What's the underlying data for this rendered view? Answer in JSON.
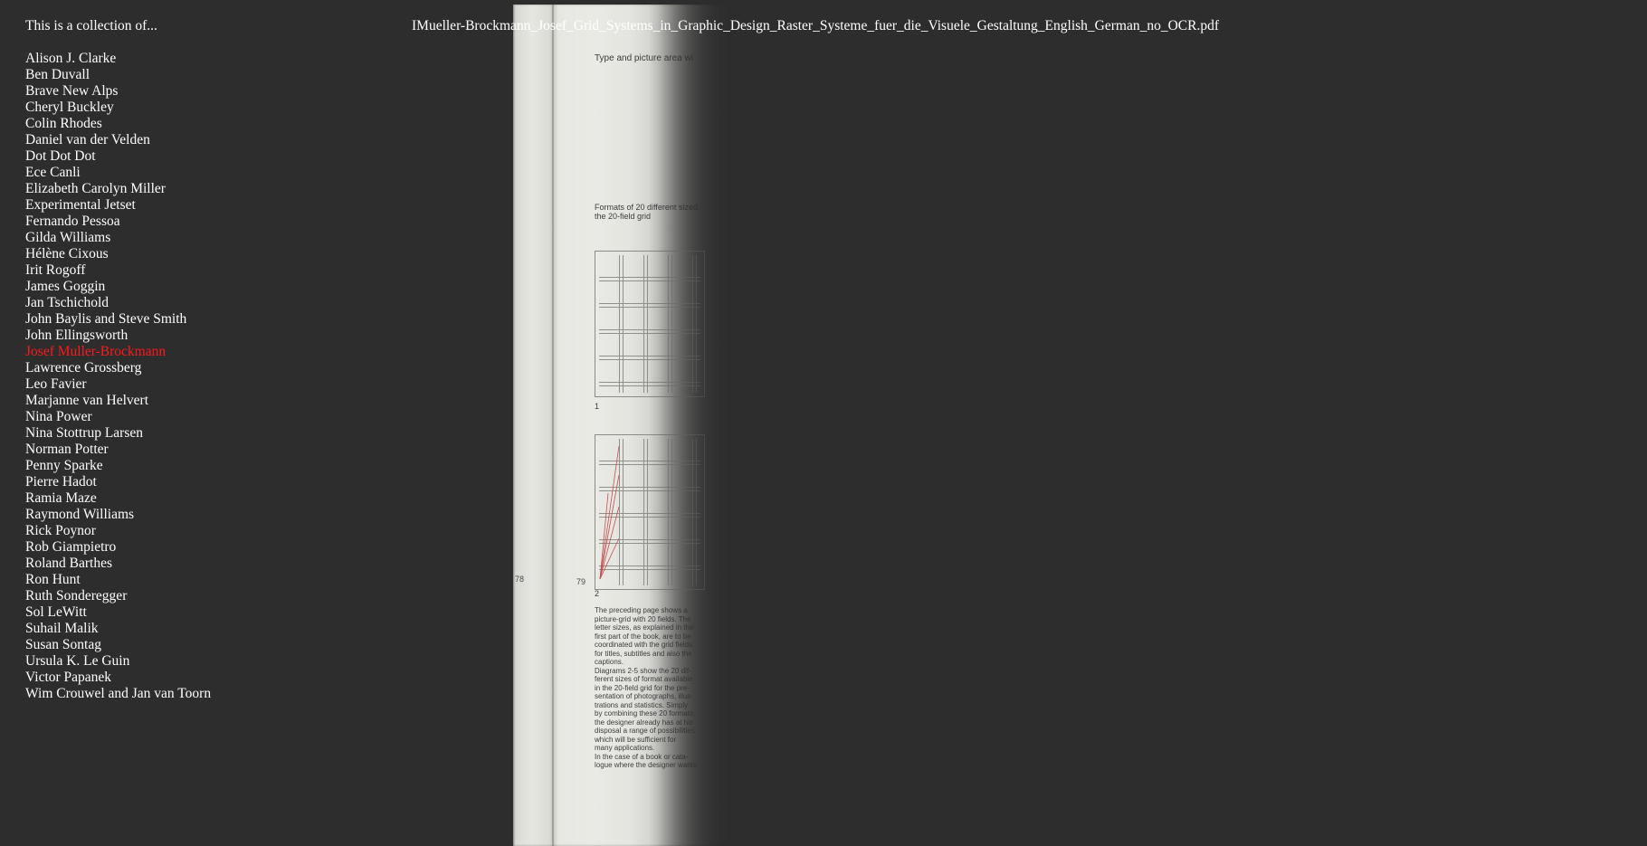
{
  "sidebar": {
    "intro": "This is a collection of...",
    "items": [
      "Alison J. Clarke",
      "Ben Duvall",
      "Brave New Alps",
      "Cheryl Buckley",
      "Colin Rhodes",
      "Daniel van der Velden",
      "Dot Dot Dot",
      "Ece Canli",
      "Elizabeth Carolyn Miller",
      "Experimental Jetset",
      "Fernando Pessoa",
      "Gilda Williams",
      "Hélène Cixous",
      "Irit Rogoff",
      "James Goggin",
      "Jan Tschichold",
      "John Baylis and Steve Smith",
      "John Ellingsworth",
      "Josef Muller-Brockmann",
      "Lawrence Grossberg",
      "Leo Favier",
      "Marjanne van Helvert",
      "Nina Power",
      "Nina Stottrup Larsen",
      "Norman Potter",
      "Penny Sparke",
      "Pierre Hadot",
      "Ramia Maze",
      "Raymond Williams",
      "Rick Poynor",
      "Rob Giampietro",
      "Roland Barthes",
      "Ron Hunt",
      "Ruth Sonderegger",
      "Sol LeWitt",
      "Suhail Malik",
      "Susan Sontag",
      "Ursula K. Le Guin",
      "Victor Papanek",
      "Wim Crouwel and Jan van Toorn"
    ],
    "active_index": 18,
    "active_color": "#ff1a1a"
  },
  "document": {
    "filename": "IMueller-Brockmann_Josef_Grid_Systems_in_Graphic_Design_Raster_Systeme_fuer_die_Visuele_Gestaltung_English_German_no_OCR.pdf",
    "page_heading": "Type and picture area wi",
    "caption_top": [
      "Formats of 20 different sized",
      "the 20-field grid"
    ],
    "figure_labels": [
      "1",
      "2"
    ],
    "page_numbers": [
      "78",
      "79"
    ],
    "body_text": [
      "The preceding page shows a",
      "picture-grid with 20 fields. The",
      "letter sizes, as explained in the",
      "first part of the book, are to be",
      "coordinated with the grid fields",
      "for titles, subtitles and also the",
      "captions.",
      "Diagrams 2-5 show the 20 dif-",
      "ferent sizes of format available",
      "in the 20-field grid for the pre-",
      "sentation of photographs, illus-",
      "trations and statistics. Simply",
      "by combining these 20 formats,",
      "the designer already has at his",
      "disposal a range of possibilities",
      "which will be sufficient for",
      "many applications.",
      "In the case of a book or cata-",
      "logue where the designer wants"
    ]
  }
}
